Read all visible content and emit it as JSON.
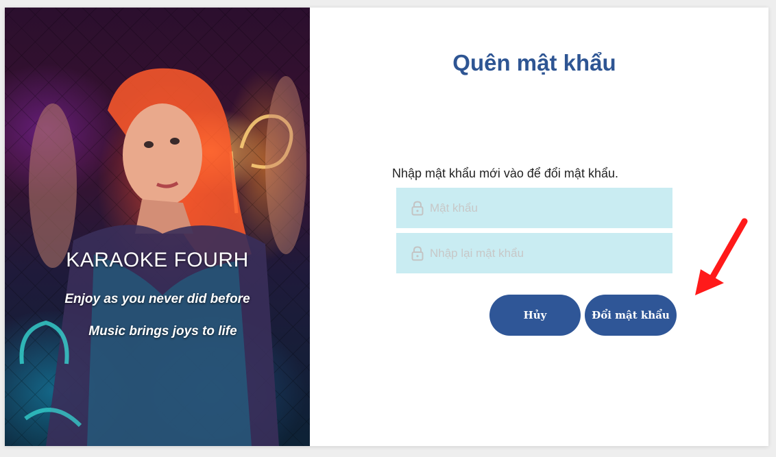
{
  "hero": {
    "brand": "KARAOKE FOURH",
    "tagline_1": "Enjoy as you never did before",
    "tagline_2": "Music brings joys to life"
  },
  "form": {
    "title": "Quên mật khẩu",
    "instruction": "Nhập mật khẩu mới vào để đổi mật khẩu.",
    "password_placeholder": "Mật khẩu",
    "password_value": "",
    "confirm_placeholder": "Nhập lại mật khẩu",
    "confirm_value": "",
    "cancel_label": "Hủy",
    "submit_label": "Đổi mật khẩu"
  },
  "icons": {
    "password": "lock-icon",
    "confirm": "lock-icon",
    "annotation": "red-arrow-icon"
  },
  "colors": {
    "accent": "#2f5697",
    "title": "#2e5593",
    "field_background": "#c9ecf2",
    "annotation_arrow": "#ff1a1a"
  }
}
